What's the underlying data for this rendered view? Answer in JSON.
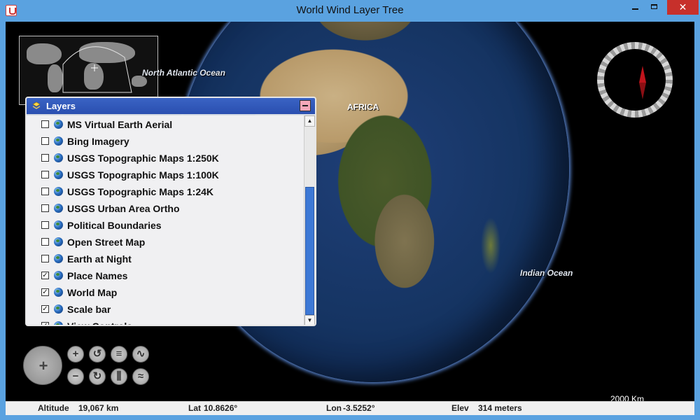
{
  "window": {
    "title": "World Wind Layer Tree",
    "close_glyph": "✕"
  },
  "map": {
    "labels": {
      "north_atlantic": "North Atlantic Ocean",
      "africa": "AFRICA",
      "indian": "Indian Ocean"
    },
    "scale_label": "2000 Km"
  },
  "layers_panel": {
    "title": "Layers",
    "items": [
      {
        "label": "MS Virtual Earth Aerial",
        "checked": false
      },
      {
        "label": "Bing Imagery",
        "checked": false
      },
      {
        "label": "USGS Topographic Maps 1:250K",
        "checked": false
      },
      {
        "label": "USGS Topographic Maps 1:100K",
        "checked": false
      },
      {
        "label": "USGS Topographic Maps 1:24K",
        "checked": false
      },
      {
        "label": "USGS Urban Area Ortho",
        "checked": false
      },
      {
        "label": "Political Boundaries",
        "checked": false
      },
      {
        "label": "Open Street Map",
        "checked": false
      },
      {
        "label": "Earth at Night",
        "checked": false
      },
      {
        "label": "Place Names",
        "checked": true
      },
      {
        "label": "World Map",
        "checked": true
      },
      {
        "label": "Scale bar",
        "checked": true
      },
      {
        "label": "View Controls",
        "checked": true
      }
    ]
  },
  "status": {
    "altitude_label": "Altitude",
    "altitude_value": "19,067 km",
    "lat_label": "Lat",
    "lat_value": "10.8626°",
    "lon_label": "Lon",
    "lon_value": "-3.5252°",
    "elev_label": "Elev",
    "elev_value": "314 meters"
  },
  "colors": {
    "titlebar": "#5aa2e0",
    "close_button": "#c7302b",
    "layers_header": "#2a4fb0",
    "scroll_thumb": "#3d79d6",
    "compass_needle": "#c0141c"
  }
}
